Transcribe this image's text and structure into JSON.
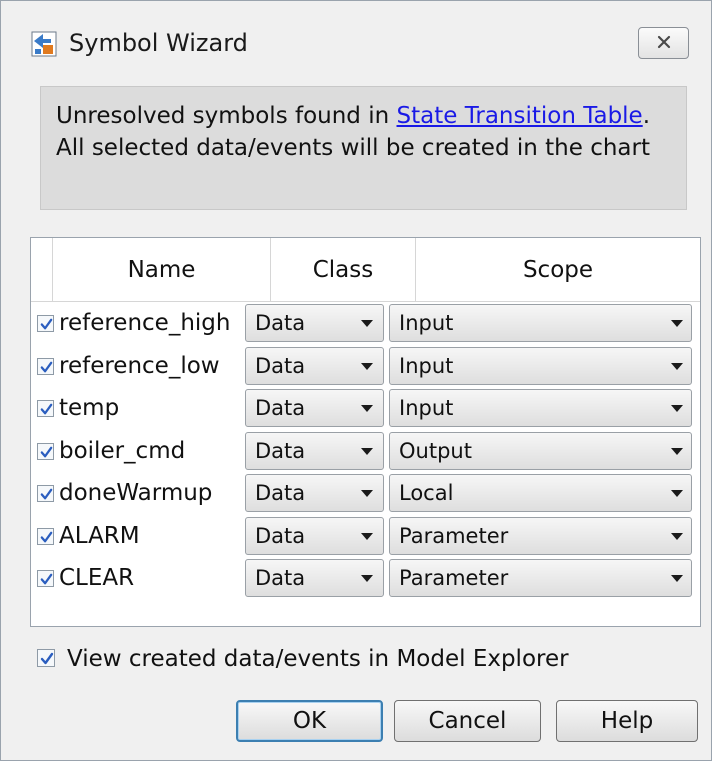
{
  "window": {
    "title": "Symbol Wizard"
  },
  "info": {
    "line1_prefix": "Unresolved symbols found in ",
    "line1_link": "State Transition Table",
    "line1_suffix": ".",
    "line2": "All selected data/events will be created in the chart"
  },
  "table": {
    "columns": [
      "Name",
      "Class",
      "Scope"
    ],
    "rows": [
      {
        "checked": true,
        "name": "reference_high",
        "class": "Data",
        "scope": "Input"
      },
      {
        "checked": true,
        "name": "reference_low",
        "class": "Data",
        "scope": "Input"
      },
      {
        "checked": true,
        "name": "temp",
        "class": "Data",
        "scope": "Input"
      },
      {
        "checked": true,
        "name": "boiler_cmd",
        "class": "Data",
        "scope": "Output"
      },
      {
        "checked": true,
        "name": "doneWarmup",
        "class": "Data",
        "scope": "Local"
      },
      {
        "checked": true,
        "name": "ALARM",
        "class": "Data",
        "scope": "Parameter"
      },
      {
        "checked": true,
        "name": "CLEAR",
        "class": "Data",
        "scope": "Parameter"
      }
    ]
  },
  "footer": {
    "view_checkbox_checked": true,
    "view_label": "View created data/events in Model Explorer"
  },
  "buttons": {
    "ok": "OK",
    "cancel": "Cancel",
    "help": "Help"
  },
  "colors": {
    "dialog_bg": "#f0f0f0",
    "info_bg": "#dcdcdc",
    "link": "#1a1ae6",
    "check": "#2a5dbf"
  },
  "icons": {
    "app": "symbol-wizard-app-icon",
    "close": "close-icon",
    "checkbox": "checkmark-icon",
    "dropdown": "chevron-down-icon"
  }
}
